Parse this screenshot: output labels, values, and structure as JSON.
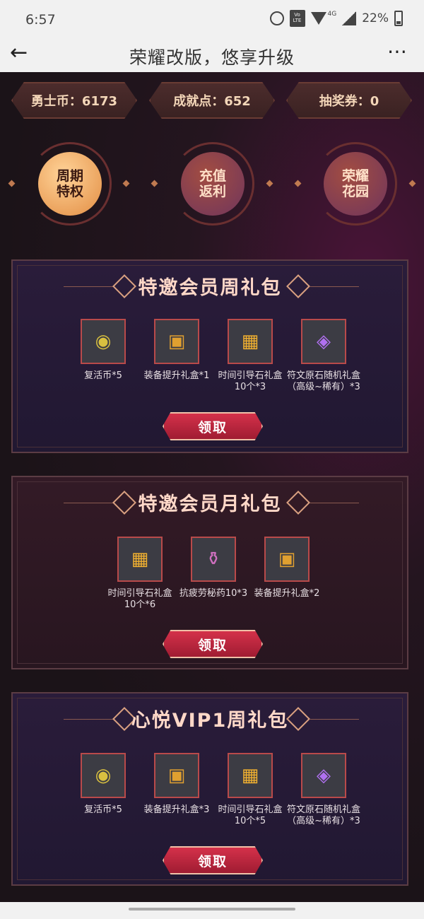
{
  "status": {
    "time": "6:57",
    "battery": "22%",
    "network": "4G",
    "volte": "Vo LTE"
  },
  "nav": {
    "title": "荣耀改版，悠享升级",
    "back_icon": "←",
    "more_icon": "⋯"
  },
  "currencies": [
    {
      "label": "勇士币：6173"
    },
    {
      "label": "成就点：652"
    },
    {
      "label": "抽奖券：0"
    }
  ],
  "tabs": [
    {
      "line1": "周期",
      "line2": "特权",
      "state": "active"
    },
    {
      "line1": "充值",
      "line2": "返利",
      "state": "inactive"
    },
    {
      "line1": "荣耀",
      "line2": "花园",
      "state": "inactive"
    }
  ],
  "packs": [
    {
      "title": "特邀会员周礼包",
      "claim_label": "领取",
      "items": [
        {
          "icon": "revive-coin",
          "glyph": "◉",
          "label": "复活币*5"
        },
        {
          "icon": "gear-upgrade-box",
          "glyph": "▣",
          "label": "装备提升礼盒*1"
        },
        {
          "icon": "time-guide-stone-box",
          "glyph": "▦",
          "label": "时间引导石礼盒10个*3"
        },
        {
          "icon": "rune-stone-box",
          "glyph": "◈",
          "label": "符文原石随机礼盒（高级~稀有）*3"
        }
      ]
    },
    {
      "title": "特邀会员月礼包",
      "claim_label": "领取",
      "items": [
        {
          "icon": "time-guide-stone-box",
          "glyph": "▦",
          "label": "时间引导石礼盒10个*6"
        },
        {
          "icon": "anti-fatigue-potion",
          "glyph": "⚱",
          "label": "抗疲劳秘药10*3"
        },
        {
          "icon": "gear-upgrade-box",
          "glyph": "▣",
          "label": "装备提升礼盒*2"
        }
      ]
    },
    {
      "title": "心悦VIP1周礼包",
      "claim_label": "领取",
      "items": [
        {
          "icon": "revive-coin",
          "glyph": "◉",
          "label": "复活币*5"
        },
        {
          "icon": "gear-upgrade-box",
          "glyph": "▣",
          "label": "装备提升礼盒*3"
        },
        {
          "icon": "time-guide-stone-box",
          "glyph": "▦",
          "label": "时间引导石礼盒10个*5"
        },
        {
          "icon": "rune-stone-box",
          "glyph": "◈",
          "label": "符文原石随机礼盒（高级~稀有）*3"
        }
      ]
    }
  ],
  "colors": {
    "accent": "#d4314a",
    "gold": "#f3d6b8",
    "item_border": "#b94a4a"
  }
}
